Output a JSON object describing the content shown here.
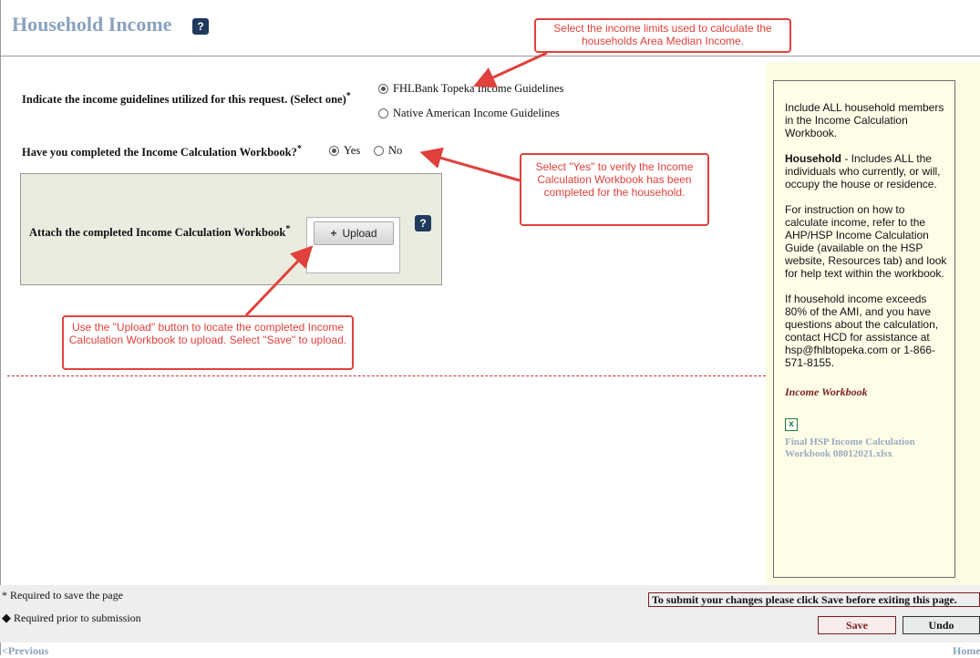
{
  "page": {
    "title": "Household Income",
    "help_label": "?"
  },
  "questions": {
    "guidelines": {
      "label": "Indicate the income guidelines utilized for this request. (Select one)",
      "required_mark": "*",
      "options": [
        {
          "label": "FHLBank Topeka Income Guidelines",
          "selected": true
        },
        {
          "label": "Native American Income Guidelines",
          "selected": false
        }
      ]
    },
    "workbook_completed": {
      "label": "Have you completed the Income Calculation Workbook?",
      "required_mark": "*",
      "options": [
        {
          "label": "Yes",
          "selected": true
        },
        {
          "label": "No",
          "selected": false
        }
      ]
    },
    "attach": {
      "label": "Attach the completed Income Calculation Workbook",
      "required_mark": "*",
      "upload_label": "Upload",
      "upload_icon": "plus-icon"
    }
  },
  "callouts": {
    "income_limits": "Select the income limits used to calculate the households Area Median Income.",
    "verify_yes": "Select \"Yes\" to verify the Income Calculation Workbook has been completed for the household.",
    "upload": "Use the \"Upload\" button to locate the completed Income Calculation Workbook to upload.  Select \"Save\" to upload."
  },
  "sidebar": {
    "p1": "Include ALL household members in the Income Calculation Workbook.",
    "p2_bold": "Household",
    "p2_rest": " - Includes ALL the individuals who currently, or will, occupy the house or residence.",
    "p3": "For instruction on how to calculate income, refer to the AHP/HSP Income Calculation Guide (available on the HSP website, Resources tab) and look for help text within the workbook.",
    "p4": "If household income exceeds 80% of the AMI, and you have questions about the calculation, contact HCD for assistance at hsp@fhlbtopeka.com or 1-866-571-8155.",
    "workbook_heading": "Income Workbook",
    "file_icon": "excel-file-icon",
    "file_name": "Final HSP Income Calculation Workbook 08012021.xlsx"
  },
  "footer": {
    "required_save": "* Required to save the page",
    "required_submit": "Required prior to submission",
    "submit_note": "To submit your changes please click Save before exiting this page.",
    "save_label": "Save",
    "undo_label": "Undo",
    "previous_label": "<Previous",
    "home_label": "Home"
  },
  "colors": {
    "accent_title": "#8aa2bf",
    "callout_red": "#e0413c",
    "sidebar_bg": "#fcfce4",
    "upload_panel_bg": "#e9ecdf"
  }
}
